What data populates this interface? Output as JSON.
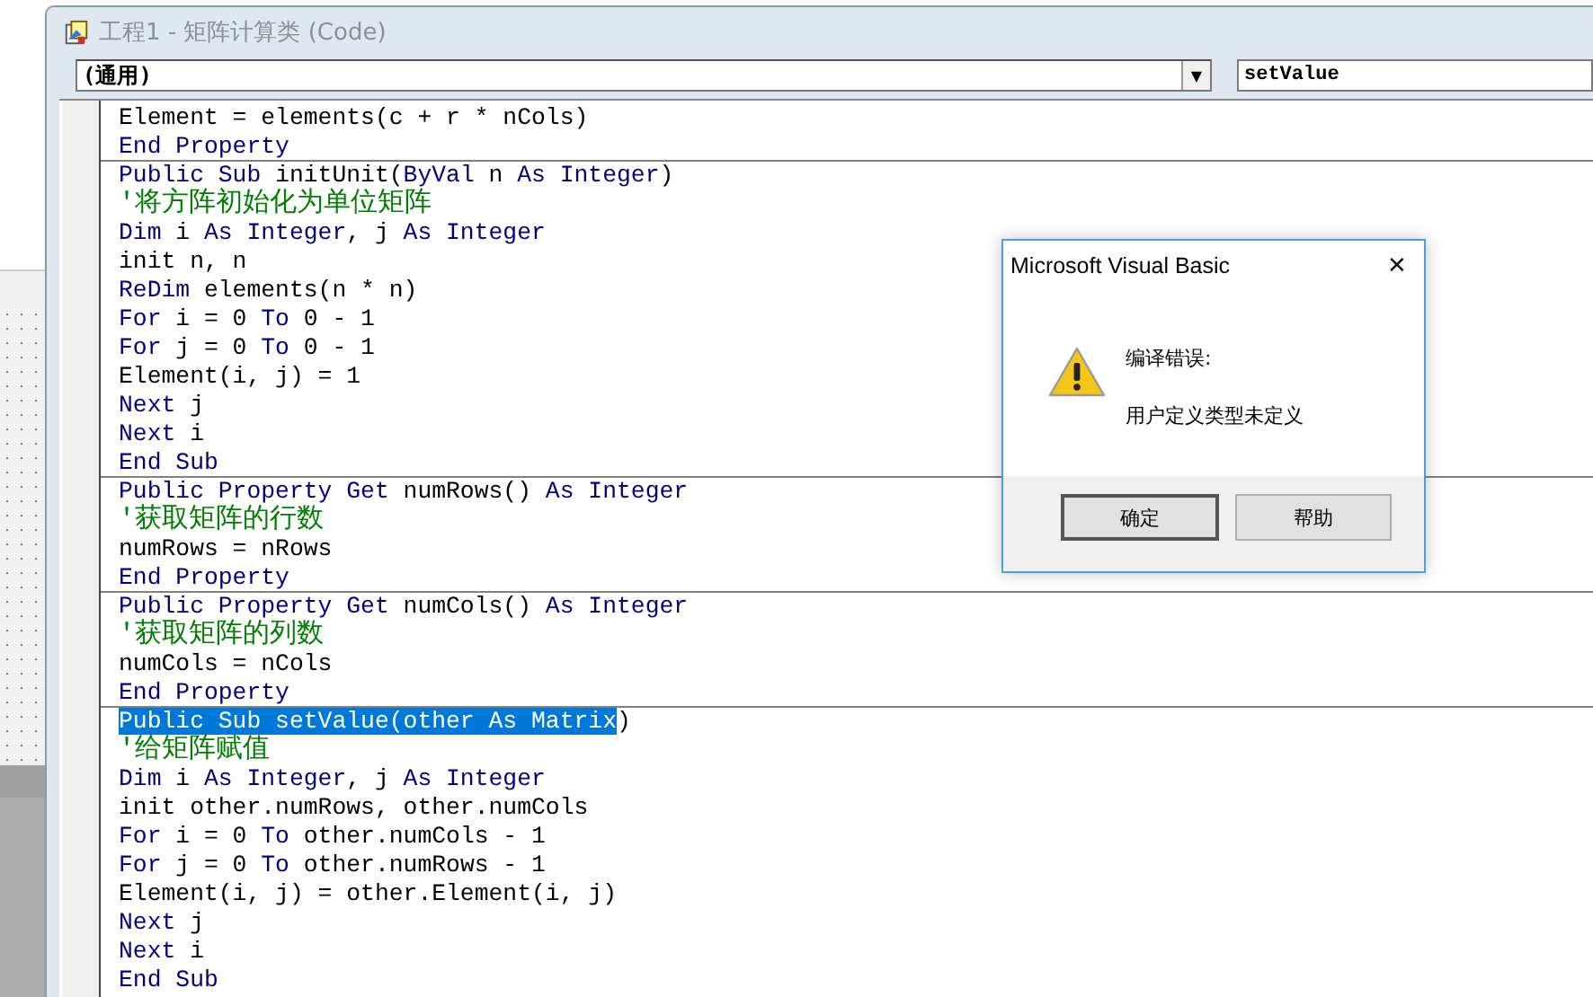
{
  "window": {
    "title": "工程1 - 矩阵计算类 (Code)"
  },
  "object_combo": {
    "value": "(通用)",
    "arrow": "▼"
  },
  "procedure_combo": {
    "value": "setValue"
  },
  "code": {
    "procedures": [
      {
        "lines": [
          [
            {
              "text": "Element = elements(c + r * nCols)",
              "kind": "id"
            }
          ],
          [
            {
              "text": "End Property",
              "kind": "kw"
            }
          ]
        ]
      },
      {
        "lines": [
          [
            {
              "text": "Public Sub ",
              "kind": "kw"
            },
            {
              "text": "initUnit(",
              "kind": "id"
            },
            {
              "text": "ByVal ",
              "kind": "kw"
            },
            {
              "text": "n ",
              "kind": "id"
            },
            {
              "text": "As Integer",
              "kind": "kw"
            },
            {
              "text": ")",
              "kind": "id"
            }
          ],
          [
            {
              "text": "'将方阵初始化为单位矩阵",
              "kind": "comment"
            }
          ],
          [
            {
              "text": "Dim ",
              "kind": "kw"
            },
            {
              "text": "i ",
              "kind": "id"
            },
            {
              "text": "As Integer",
              "kind": "kw"
            },
            {
              "text": ", j ",
              "kind": "id"
            },
            {
              "text": "As Integer",
              "kind": "kw"
            }
          ],
          [
            {
              "text": "init n, n",
              "kind": "id"
            }
          ],
          [
            {
              "text": "ReDim ",
              "kind": "kw"
            },
            {
              "text": "elements(n * n)",
              "kind": "id"
            }
          ],
          [
            {
              "text": "For ",
              "kind": "kw"
            },
            {
              "text": "i = 0 ",
              "kind": "id"
            },
            {
              "text": "To ",
              "kind": "kw"
            },
            {
              "text": "0 - 1",
              "kind": "id"
            }
          ],
          [
            {
              "text": "For ",
              "kind": "kw"
            },
            {
              "text": "j = 0 ",
              "kind": "id"
            },
            {
              "text": "To ",
              "kind": "kw"
            },
            {
              "text": "0 - 1",
              "kind": "id"
            }
          ],
          [
            {
              "text": "Element(i, j) = 1",
              "kind": "id"
            }
          ],
          [
            {
              "text": "Next ",
              "kind": "kw"
            },
            {
              "text": "j",
              "kind": "id"
            }
          ],
          [
            {
              "text": "Next ",
              "kind": "kw"
            },
            {
              "text": "i",
              "kind": "id"
            }
          ],
          [
            {
              "text": "End Sub",
              "kind": "kw"
            }
          ]
        ]
      },
      {
        "lines": [
          [
            {
              "text": "Public Property Get ",
              "kind": "kw"
            },
            {
              "text": "numRows() ",
              "kind": "id"
            },
            {
              "text": "As Integer",
              "kind": "kw"
            }
          ],
          [
            {
              "text": "'获取矩阵的行数",
              "kind": "comment"
            }
          ],
          [
            {
              "text": "numRows = nRows",
              "kind": "id"
            }
          ],
          [
            {
              "text": "End Property",
              "kind": "kw"
            }
          ]
        ]
      },
      {
        "lines": [
          [
            {
              "text": "Public Property Get ",
              "kind": "kw"
            },
            {
              "text": "numCols() ",
              "kind": "id"
            },
            {
              "text": "As Integer",
              "kind": "kw"
            }
          ],
          [
            {
              "text": "'获取矩阵的列数",
              "kind": "comment"
            }
          ],
          [
            {
              "text": "numCols = nCols",
              "kind": "id"
            }
          ],
          [
            {
              "text": "End Property",
              "kind": "kw"
            }
          ]
        ]
      },
      {
        "lines": [
          [
            {
              "text": "Public Sub setValue(other As Matrix",
              "kind": "selected"
            },
            {
              "text": ")",
              "kind": "id"
            }
          ],
          [
            {
              "text": "'给矩阵赋值",
              "kind": "comment"
            }
          ],
          [
            {
              "text": "Dim ",
              "kind": "kw"
            },
            {
              "text": "i ",
              "kind": "id"
            },
            {
              "text": "As Integer",
              "kind": "kw"
            },
            {
              "text": ", j ",
              "kind": "id"
            },
            {
              "text": "As Integer",
              "kind": "kw"
            }
          ],
          [
            {
              "text": "init other.numRows, other.numCols",
              "kind": "id"
            }
          ],
          [
            {
              "text": "For ",
              "kind": "kw"
            },
            {
              "text": "i = 0 ",
              "kind": "id"
            },
            {
              "text": "To ",
              "kind": "kw"
            },
            {
              "text": "other.numCols - 1",
              "kind": "id"
            }
          ],
          [
            {
              "text": "For ",
              "kind": "kw"
            },
            {
              "text": "j = 0 ",
              "kind": "id"
            },
            {
              "text": "To ",
              "kind": "kw"
            },
            {
              "text": "other.numRows - 1",
              "kind": "id"
            }
          ],
          [
            {
              "text": "Element(i, j) = other.Element(i, j)",
              "kind": "id"
            }
          ],
          [
            {
              "text": "Next ",
              "kind": "kw"
            },
            {
              "text": "j",
              "kind": "id"
            }
          ],
          [
            {
              "text": "Next ",
              "kind": "kw"
            },
            {
              "text": "i",
              "kind": "id"
            }
          ],
          [
            {
              "text": "End Sub",
              "kind": "kw"
            }
          ]
        ]
      }
    ]
  },
  "dialog": {
    "title": "Microsoft Visual Basic",
    "close": "✕",
    "heading": "编译错误:",
    "message": "用户定义类型未定义",
    "buttons": [
      {
        "label": "确定",
        "default": true
      },
      {
        "label": "帮助",
        "default": false
      }
    ]
  }
}
